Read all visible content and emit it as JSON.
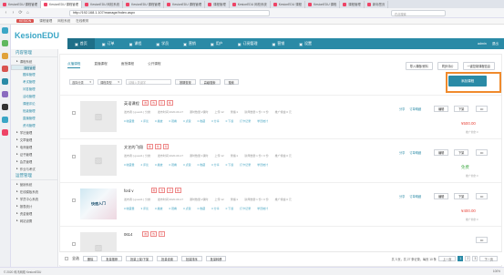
{
  "browser": {
    "tabs": [
      "KesionEDU 课程管理",
      "KesionEDU 课程管理",
      "KesionEDU 网校系统",
      "KesionEDU 课程管理",
      "KesionEDU 课程管理",
      "课程管理",
      "KesionEDU 网校系统",
      "KesionEDU 课程",
      "KesionEDU 课程",
      "课程管理",
      "新标签页"
    ],
    "url": "http://192.168.1.107/manage/Index.aspx",
    "search_placeholder": "在此搜索",
    "bookmarks": [
      "KESION",
      "课程管理",
      "网校系统",
      "在线教育"
    ]
  },
  "header": {
    "logo": "KesionEDU",
    "nav": [
      {
        "label": "首页",
        "active": true
      },
      {
        "label": "订单"
      },
      {
        "label": "课程"
      },
      {
        "label": "学员"
      },
      {
        "label": "营销"
      },
      {
        "label": "用户"
      },
      {
        "label": "订阅管理"
      },
      {
        "label": "营销"
      },
      {
        "label": "设置"
      }
    ],
    "right": [
      "admin",
      "退出"
    ]
  },
  "sidebar": {
    "title": "内容管理",
    "items": [
      {
        "label": "课程系统",
        "type": "group"
      },
      {
        "label": "课程管理",
        "type": "child",
        "selected": true
      },
      {
        "label": "题库管理",
        "type": "child"
      },
      {
        "label": "考试管理",
        "type": "child"
      },
      {
        "label": "问答管理",
        "type": "child"
      },
      {
        "label": "活动管理",
        "type": "child"
      },
      {
        "label": "课程评论",
        "type": "child"
      },
      {
        "label": "班级管理",
        "type": "child"
      },
      {
        "label": "直播管理",
        "type": "child"
      },
      {
        "label": "资讯管理",
        "type": "child"
      },
      {
        "label": "学社管理",
        "type": "group"
      },
      {
        "label": "文章管理",
        "type": "group"
      },
      {
        "label": "电商管理",
        "type": "group"
      },
      {
        "label": "证书管理",
        "type": "group"
      },
      {
        "label": "会员管理",
        "type": "group"
      },
      {
        "label": "作业与考试",
        "type": "group"
      }
    ],
    "section2": "运营管理",
    "items2": [
      {
        "label": "营销系统"
      },
      {
        "label": "在线模板系统"
      },
      {
        "label": "学员中心系统"
      },
      {
        "label": "报表统计"
      },
      {
        "label": "资金管理"
      },
      {
        "label": "网站设置"
      }
    ]
  },
  "content": {
    "subtabs": [
      {
        "label": "点播课程",
        "on": true
      },
      {
        "label": "直播课程"
      },
      {
        "label": "面授课程"
      },
      {
        "label": "公开课程"
      }
    ],
    "top_buttons": [
      "导入课程/资料",
      "同步评价",
      "一键复制课程信息"
    ],
    "add_button": "添加课程",
    "filters": {
      "category": "选择分类",
      "type": "课程类型",
      "keyword_placeholder": "请输入关键字",
      "tag": "按期查找",
      "advanced": "高级搜索",
      "search": "搜索"
    },
    "courses": [
      {
        "title": "英语课程",
        "tags": [
          "推",
          "热",
          "荐",
          "精"
        ],
        "meta": [
          "发布者:[ guest1 ] 分类:",
          "发布时间:2020-09-17",
          "课时数量:2课时",
          "上传:12",
          "录播:1",
          "讲师数量:1 份 / 0 份",
          "推广佣金:0 元"
        ],
        "stats": [
          "0 收藏量",
          "1 评论",
          "0 播放",
          "0 观看",
          "0 点赞",
          "0 收藏",
          "0 分享",
          "0 下载",
          "打卡记录",
          "学员统计"
        ],
        "price": "¥500.00",
        "price_sub": "推广佣金:0",
        "placeholder": true
      },
      {
        "title": "文艺的飞翔",
        "tags": [
          "推",
          "热",
          "荐"
        ],
        "meta": [
          "发布者:[ guest1 ] 分类:",
          "发布时间:2020-09-17",
          "课时数量:1课时",
          "上传:12",
          "录播:1",
          "讲师数量:1 份 / 0 份",
          "推广佣金:0 元"
        ],
        "stats": [
          "0 收藏量",
          "2 评论",
          "0 播放",
          "0 观看",
          "0 点赞",
          "0 收藏",
          "0 分享",
          "0 下载",
          "打卡记录",
          "学员统计"
        ],
        "price": "免费",
        "price_sub": "推广佣金:0",
        "placeholder": true
      },
      {
        "title": "ford v",
        "tags": [
          "推",
          "热",
          "荐",
          "精"
        ],
        "meta": [
          "发布者:[ guest1 ] 分类:",
          "发布时间:2020-09-17",
          "课时数量:2课时",
          "上传:12",
          "录播:1",
          "讲师数量:1 份 / 0 份",
          "推广佣金:0 元"
        ],
        "stats": [
          "0 收藏量",
          "3 评论",
          "0 播放",
          "0 观看",
          "0 点赞",
          "0 收藏",
          "0 分享",
          "0 下载",
          "打卡记录",
          "学员统计"
        ],
        "price": "¥400.00",
        "price_sub": "推广佣金:0",
        "thumb_text": "快速入门",
        "placeholder": false
      },
      {
        "title": "0614",
        "tags": [
          "推",
          "热",
          "荐"
        ],
        "meta": [],
        "stats": [],
        "price": "",
        "price_sub": "",
        "placeholder": true
      }
    ],
    "row_actions": [
      "分享",
      "订单明细",
      "编辑",
      "下架"
    ],
    "more": "•••",
    "bottom": {
      "checkall": "全选",
      "buttons": [
        "删除",
        "批量推荐",
        "批量上架/下架",
        "批量设置",
        "批量排序",
        "批量转移"
      ],
      "summary": "共 3 页，共 27 条记录，每页 10 条",
      "pages": [
        "上一页",
        "1",
        "2",
        "3",
        "下一页"
      ]
    }
  },
  "statusbar": {
    "left": "© 2020 科汛网络 KesionEDU",
    "right": "100%"
  }
}
